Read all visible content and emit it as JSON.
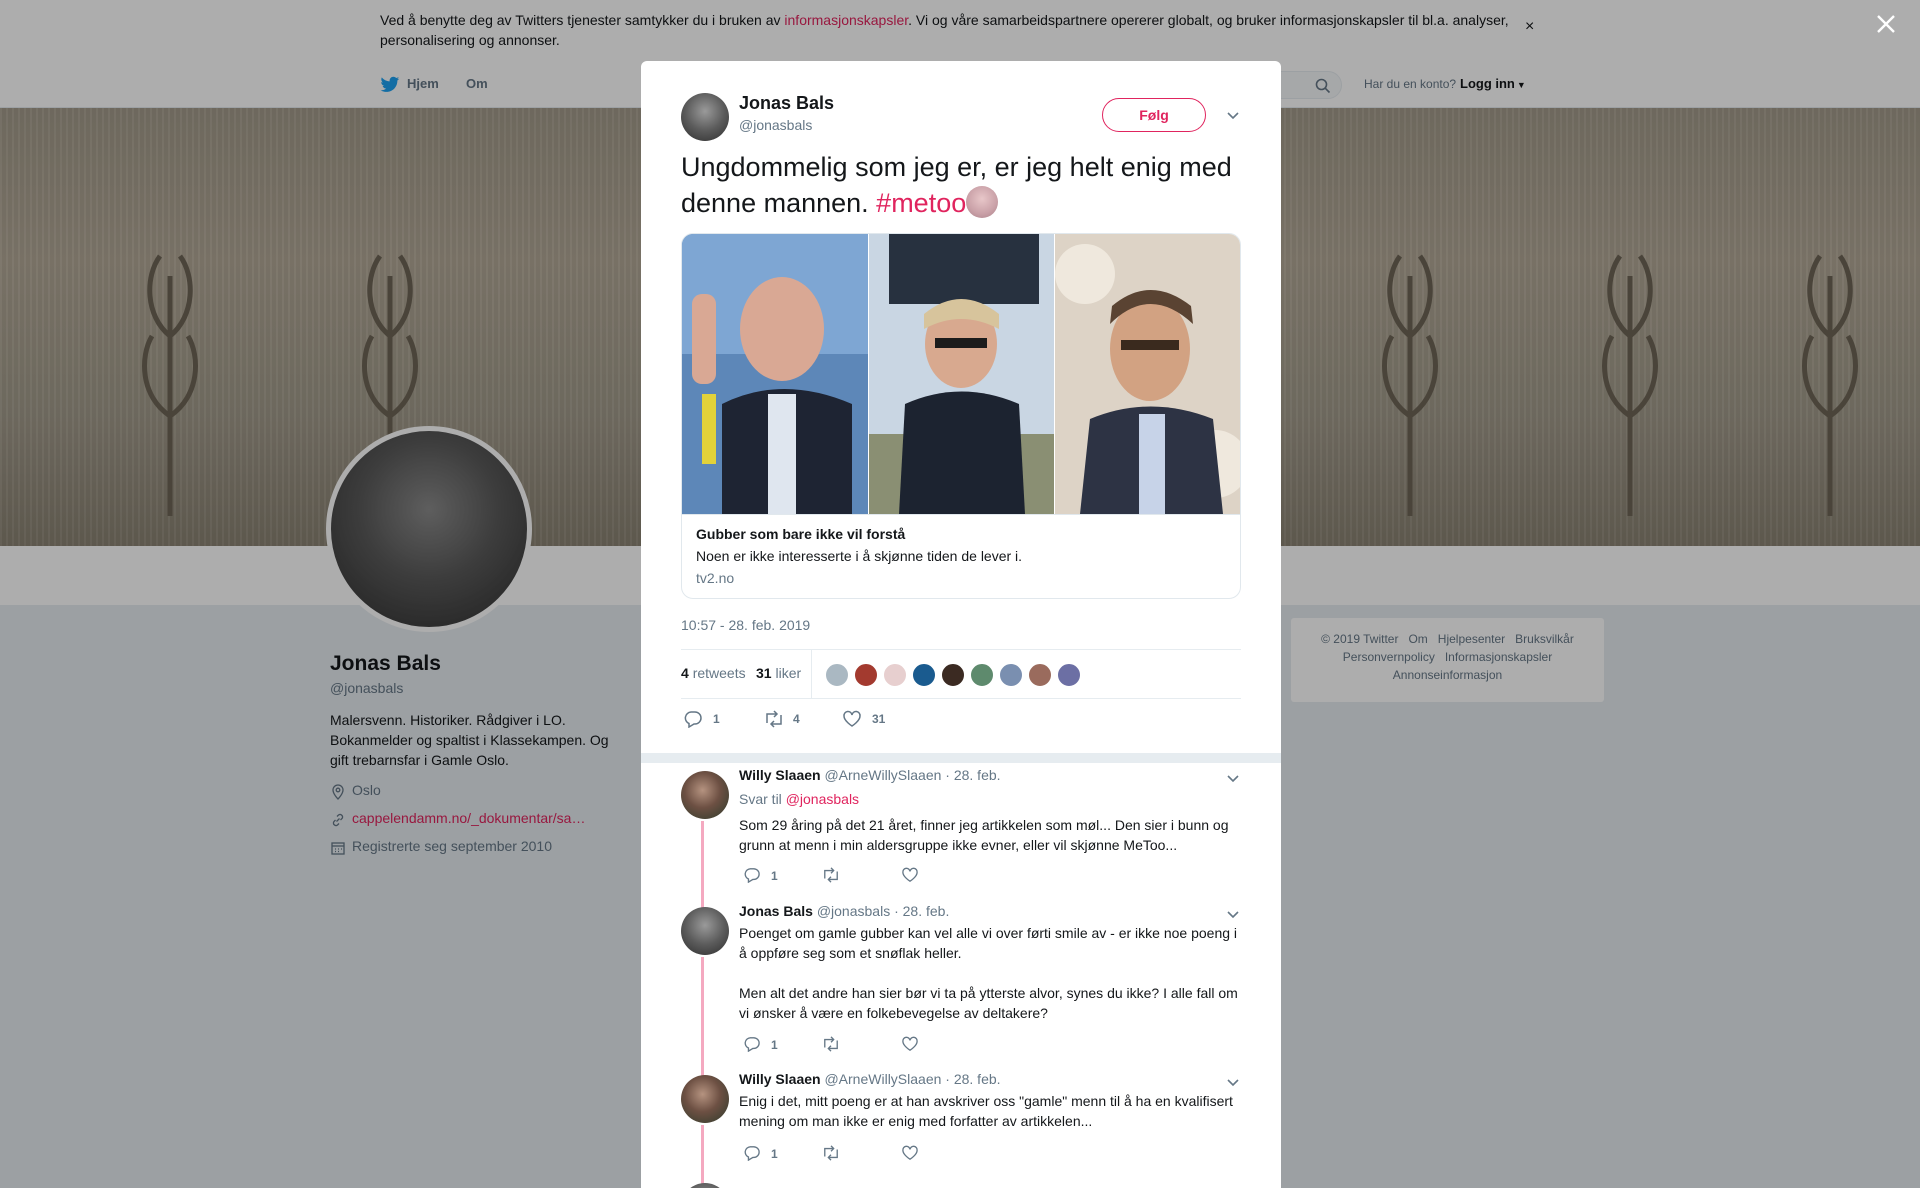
{
  "cookie": {
    "text_before": "Ved å benytte deg av Twitters tjenester samtykker du i bruken av ",
    "link": "informasjonskapsler",
    "text_after": ". Vi og våre samarbeidspartnere opererer globalt, og bruker informasjonskapsler til bl.a. analyser, personalisering og annonser.",
    "close": "×"
  },
  "nav": {
    "home": "Hjem",
    "about": "Om",
    "login_question": "Har du en konto?",
    "login": "Logg inn"
  },
  "profile": {
    "name": "Jonas Bals",
    "handle": "@jonasbals",
    "bio": "Malersvenn. Historiker. Rådgiver i LO. Bokanmelder og spaltist i Klassekampen. Og gift trebarnsfar i Gamle Oslo.",
    "location": "Oslo",
    "url": "cappelendamm.no/_dokumentar/sa…",
    "joined": "Registrerte seg september 2010"
  },
  "footer": {
    "copyright": "© 2019 Twitter",
    "links": [
      "Om",
      "Hjelpesenter",
      "Bruksvilkår",
      "Personvernpolicy",
      "Informasjonskapsler",
      "Annonseinformasjon"
    ]
  },
  "tweet": {
    "author": "Jonas Bals",
    "handle": "@jonasbals",
    "follow": "Følg",
    "text": "Ungdommelig som jeg er, er jeg helt enig med denne mannen. ",
    "hashtag": "#metoo",
    "card": {
      "title": "Gubber som bare ikke vil forstå",
      "description": "Noen er ikke interesserte i å skjønne tiden de lever i.",
      "domain": "tv2.no"
    },
    "timestamp": "10:57 - 28. feb. 2019",
    "retweets_count": "4",
    "retweets_label": "retweets",
    "likes_count": "31",
    "likes_label": "liker",
    "actions": {
      "replies": "1",
      "retweets": "4",
      "likes": "31"
    }
  },
  "replies": [
    {
      "name": "Willy Slaaen",
      "handle": "@ArneWillySlaaen",
      "date": "· 28. feb.",
      "reply_to_label": "Svar til",
      "reply_to": "@jonasbals",
      "text": "Som 29 åring på det 21 året, finner jeg artikkelen som møl... Den sier i bunn og grunn at menn i min aldersgruppe ikke evner, eller vil skjønne MeToo...",
      "reply_count": "1"
    },
    {
      "name": "Jonas Bals",
      "handle": "@jonasbals",
      "date": "· 28. feb.",
      "text": "Poenget om gamle gubber kan vel alle vi over førti smile av - er ikke noe poeng i å oppføre seg som et snøflak heller.",
      "text2": "Men alt det andre han sier bør vi ta på ytterste alvor, synes du ikke? I alle fall om vi ønsker å være en folkebevegelse av deltakere?",
      "reply_count": "1"
    },
    {
      "name": "Willy Slaaen",
      "handle": "@ArneWillySlaaen",
      "date": "· 28. feb.",
      "text": "Enig i det, mitt poeng er at han avskriver oss \"gamle\" menn til å ha en kvalifisert mening om man ikke er enig med forfatter av artikkelen...",
      "reply_count": "1"
    }
  ],
  "colors": {
    "accent": "#e0245e",
    "text": "#14171a",
    "secondary": "#657786",
    "twitter_blue": "#1da1f2"
  }
}
